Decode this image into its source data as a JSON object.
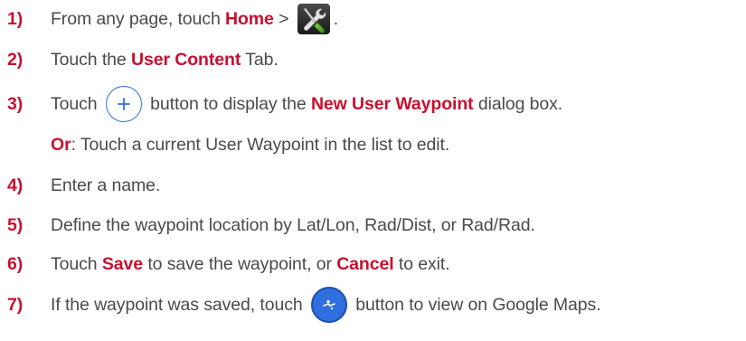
{
  "steps": [
    {
      "num": "1)",
      "before": "From any page, touch ",
      "em1": "Home",
      "after1": " > ",
      "icon": "wrench-screwdriver-icon",
      "after2": "."
    },
    {
      "num": "2)",
      "before": "Touch the ",
      "em1": "User Content",
      "after1": " Tab."
    },
    {
      "num": "3)",
      "before": "Touch ",
      "icon": "plus-icon",
      "after1": " button to display the ",
      "em1": "New User Waypoint",
      "after2": " dialog box."
    },
    {
      "num": "",
      "em1": "Or",
      "after1": ": Touch a current User Waypoint in the list to edit."
    },
    {
      "num": "4)",
      "before": "Enter a name."
    },
    {
      "num": "5)",
      "before": "Define the waypoint location by Lat/Lon, Rad/Dist, or Rad/Rad."
    },
    {
      "num": "6)",
      "before": "Touch ",
      "em1": "Save",
      "after1": " to save the waypoint, or ",
      "em2": "Cancel",
      "after2": " to exit."
    },
    {
      "num": "7)",
      "before": "If the waypoint was saved, touch ",
      "icon": "google-maps-icon",
      "after1": " button to view on Google Maps."
    }
  ],
  "colors": {
    "accent": "#c8102e",
    "text": "#4a4a4a",
    "button_blue": "#2f6fe0"
  }
}
